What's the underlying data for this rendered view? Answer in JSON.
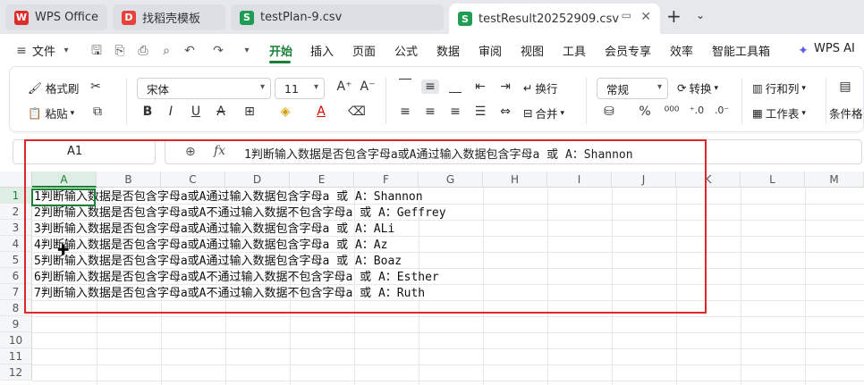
{
  "tabs": [
    {
      "label": "WPS Office",
      "icon": "wps-logo"
    },
    {
      "label": "找稻壳模板",
      "icon": "docer-icon"
    },
    {
      "label": "testPlan-9.csv",
      "icon": "sheet-icon"
    },
    {
      "label": "testResult20252909.csv",
      "icon": "sheet-icon"
    }
  ],
  "menu": {
    "file": "文件",
    "items": [
      "开始",
      "插入",
      "页面",
      "公式",
      "数据",
      "审阅",
      "视图",
      "工具",
      "会员专享",
      "效率",
      "智能工具箱"
    ],
    "ai": "WPS AI"
  },
  "ribbon": {
    "format_painter": "格式刷",
    "paste": "粘贴",
    "font_name": "宋体",
    "font_size": "11",
    "wrap": "换行",
    "merge": "合并",
    "number_format": "常规",
    "convert": "转换",
    "rows_cols": "行和列",
    "worksheet": "工作表",
    "conditional": "条件格"
  },
  "formula_bar": {
    "name_box": "A1",
    "fx": "fx",
    "content": "1判断输入数据是否包含字母a或A通过输入数据包含字母a 或 A：Shannon"
  },
  "columns": [
    "A",
    "B",
    "C",
    "D",
    "E",
    "F",
    "G",
    "H",
    "I",
    "J",
    "K",
    "L",
    "M"
  ],
  "rows": [
    "1",
    "2",
    "3",
    "4",
    "5",
    "6",
    "7",
    "8",
    "9",
    "10",
    "11",
    "12"
  ],
  "cells": [
    "1判断输入数据是否包含字母a或A通过输入数据包含字母a 或 A：Shannon",
    "2判断输入数据是否包含字母a或A不通过输入数据不包含字母a 或 A：Geffrey",
    "3判断输入数据是否包含字母a或A通过输入数据包含字母a 或 A：ALi",
    "4判断输入数据是否包含字母a或A通过输入数据包含字母a 或 A：Az",
    "5判断输入数据是否包含字母a或A通过输入数据包含字母a 或 A：Boaz",
    "6判断输入数据是否包含字母a或A不通过输入数据不包含字母a 或 A：Esther",
    "7判断输入数据是否包含字母a或A不通过输入数据不包含字母a 或 A：Ruth"
  ],
  "colors": {
    "accent": "#1a7f37",
    "highlight": "#e0262b"
  }
}
